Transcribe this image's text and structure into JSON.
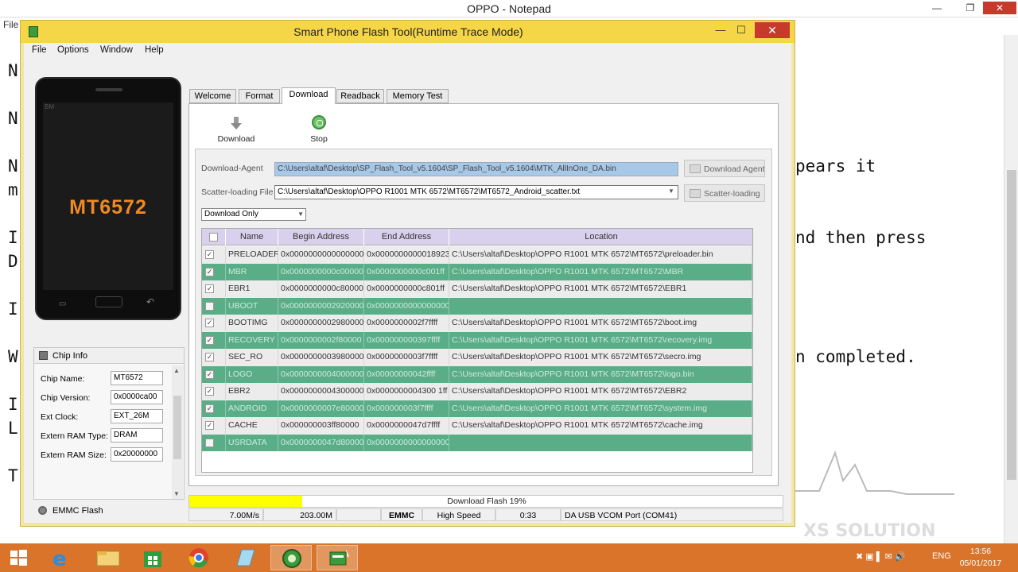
{
  "notepad": {
    "title": "OPPO - Notepad",
    "menu_first": "File",
    "lines": [
      {
        "left": "N",
        "right": ""
      },
      {
        "left": "N",
        "right": ""
      },
      {
        "left": "N",
        "right": "pears it"
      },
      {
        "left": "m",
        "right": ""
      },
      {
        "left": "I",
        "right": "nd then press"
      },
      {
        "left": "D",
        "right": ""
      },
      {
        "left": "I",
        "right": ""
      },
      {
        "left": "W",
        "right": "n completed."
      },
      {
        "left": "I",
        "right": ""
      },
      {
        "left": "L",
        "right": ""
      },
      {
        "left": "T",
        "right": ""
      }
    ],
    "watermark": "XS SOLUTION"
  },
  "tool": {
    "title": "Smart Phone Flash Tool(Runtime Trace Mode)",
    "menu": [
      "File",
      "Options",
      "Window",
      "Help"
    ],
    "phone_label": "MT6572",
    "phone_brand": "BM",
    "tabs": [
      "Welcome",
      "Format",
      "Download",
      "Readback",
      "Memory Test"
    ],
    "active_tab": "Download",
    "toolbar": {
      "download_label": "Download",
      "stop_label": "Stop"
    },
    "download_agent": {
      "label": "Download-Agent",
      "path": "C:\\Users\\altaf\\Desktop\\SP_Flash_Tool_v5.1604\\SP_Flash_Tool_v5.1604\\MTK_AllInOne_DA.bin",
      "button": "Download Agent"
    },
    "scatter": {
      "label": "Scatter-loading File",
      "path": "C:\\Users\\altaf\\Desktop\\OPPO R1001 MTK 6572\\MT6572\\MT6572_Android_scatter.txt",
      "button": "Scatter-loading"
    },
    "mode": "Download Only",
    "table": {
      "headers": [
        "",
        "Name",
        "Begin Address",
        "End Address",
        "Location"
      ],
      "rows": [
        {
          "checked": true,
          "name": "PRELOADER",
          "begin": "0x0000000000000000",
          "end": "0x0000000000018923",
          "location": "C:\\Users\\altaf\\Desktop\\OPPO R1001 MTK 6572\\MT6572\\preloader.bin"
        },
        {
          "checked": true,
          "name": "MBR",
          "begin": "0x0000000000c00000",
          "end": "0x0000000000c001ff",
          "location": "C:\\Users\\altaf\\Desktop\\OPPO R1001 MTK 6572\\MT6572\\MBR"
        },
        {
          "checked": true,
          "name": "EBR1",
          "begin": "0x0000000000c80000",
          "end": "0x0000000000c801ff",
          "location": "C:\\Users\\altaf\\Desktop\\OPPO R1001 MTK 6572\\MT6572\\EBR1"
        },
        {
          "checked": false,
          "name": "UBOOT",
          "begin": "0x0000000002920000",
          "end": "0x0000000000000000",
          "location": ""
        },
        {
          "checked": true,
          "name": "BOOTIMG",
          "begin": "0x0000000002980000",
          "end": "0x0000000002f7ffff",
          "location": "C:\\Users\\altaf\\Desktop\\OPPO R1001 MTK 6572\\MT6572\\boot.img"
        },
        {
          "checked": true,
          "name": "RECOVERY",
          "begin": "0x0000000002f80000",
          "end": "0x000000000397ffff",
          "location": "C:\\Users\\altaf\\Desktop\\OPPO R1001 MTK 6572\\MT6572\\recovery.img"
        },
        {
          "checked": true,
          "name": "SEC_RO",
          "begin": "0x0000000003980000",
          "end": "0x0000000003f7ffff",
          "location": "C:\\Users\\altaf\\Desktop\\OPPO R1001 MTK 6572\\MT6572\\secro.img"
        },
        {
          "checked": true,
          "name": "LOGO",
          "begin": "0x0000000004000000",
          "end": "0x00000000042ffff",
          "location": "C:\\Users\\altaf\\Desktop\\OPPO R1001 MTK 6572\\MT6572\\logo.bin"
        },
        {
          "checked": true,
          "name": "EBR2",
          "begin": "0x0000000004300000",
          "end": "0x0000000004300 1ff",
          "location": "C:\\Users\\altaf\\Desktop\\OPPO R1001 MTK 6572\\MT6572\\EBR2"
        },
        {
          "checked": true,
          "name": "ANDROID",
          "begin": "0x0000000007e80000",
          "end": "0x000000003f7ffff",
          "location": "C:\\Users\\altaf\\Desktop\\OPPO R1001 MTK 6572\\MT6572\\system.img"
        },
        {
          "checked": true,
          "name": "CACHE",
          "begin": "0x000000003ff80000",
          "end": "0x0000000047d7ffff",
          "location": "C:\\Users\\altaf\\Desktop\\OPPO R1001 MTK 6572\\MT6572\\cache.img"
        },
        {
          "checked": false,
          "name": "USRDATA",
          "begin": "0x0000000047d80000",
          "end": "0x0000000000000000",
          "location": ""
        }
      ]
    },
    "chip_info": {
      "title": "Chip Info",
      "fields": [
        {
          "label": "Chip Name:",
          "value": "MT6572"
        },
        {
          "label": "Chip Version:",
          "value": "0x0000ca00"
        },
        {
          "label": "Ext Clock:",
          "value": "EXT_26M"
        },
        {
          "label": "Extern RAM Type:",
          "value": "DRAM"
        },
        {
          "label": "Extern RAM Size:",
          "value": "0x20000000"
        }
      ]
    },
    "emmc_label": "EMMC Flash",
    "progress": {
      "text": "Download Flash 19%",
      "fraction": 0.19,
      "color": "#ffff00"
    },
    "status": {
      "speed": "7.00M/s",
      "size": "203.00M",
      "storage": "EMMC",
      "mode": "High Speed",
      "time": "0:33",
      "port": "DA USB VCOM Port (COM41)"
    }
  },
  "taskbar": {
    "apps": [
      "windows-start",
      "internet-explorer",
      "file-explorer",
      "store",
      "chrome",
      "notepad-app",
      "app-circle",
      "flash-tool-app"
    ],
    "language": "ENG",
    "time": "13:56",
    "date": "05/01/2017",
    "color": "#d9742a"
  }
}
